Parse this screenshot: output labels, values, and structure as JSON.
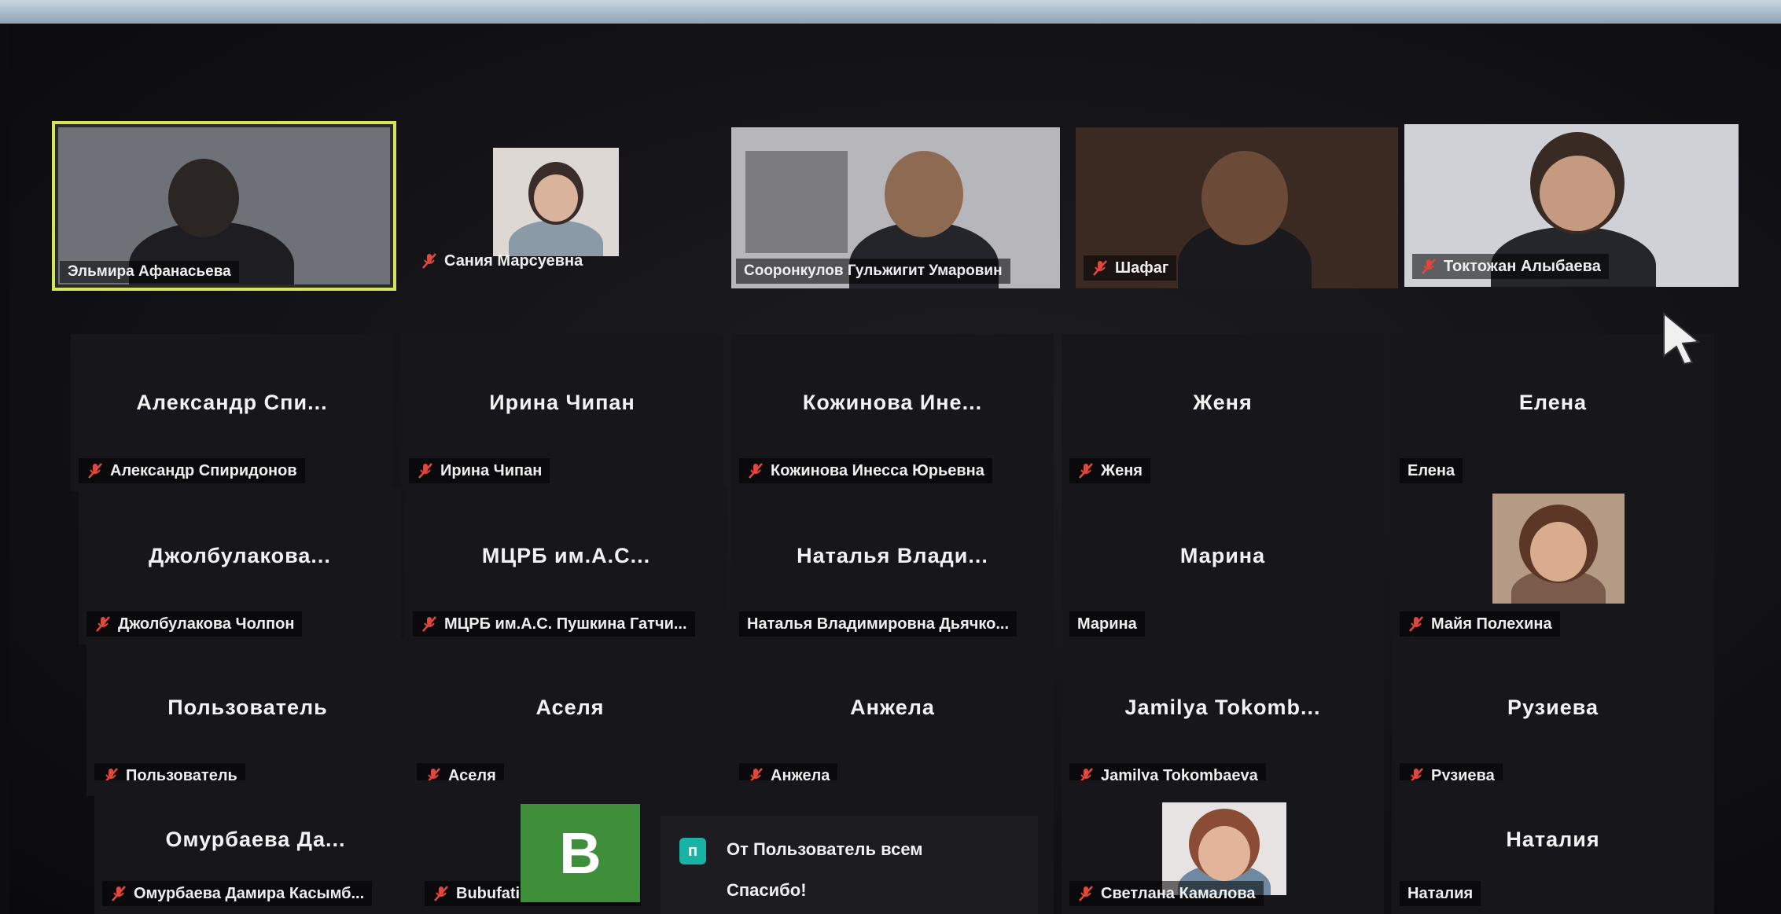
{
  "participants": [
    {
      "tile_name": "",
      "tag_name": "Эльмира Афанасьева",
      "muted": false,
      "video": true,
      "active": true
    },
    {
      "tile_name": "",
      "tag_name": "Сания Марсуевна",
      "muted": true,
      "video": true
    },
    {
      "tile_name": "",
      "tag_name": "Сооронкулов Гульжигит Умаровин",
      "muted": false,
      "video": true
    },
    {
      "tile_name": "",
      "tag_name": "Шафаг",
      "muted": true,
      "video": true
    },
    {
      "tile_name": "",
      "tag_name": "Токтожан Алыбаева",
      "muted": true,
      "video": true
    },
    {
      "tile_name": "Александр Спи...",
      "tag_name": "Александр Спиридонов",
      "muted": true
    },
    {
      "tile_name": "Ирина Чипан",
      "tag_name": "Ирина Чипан",
      "muted": true
    },
    {
      "tile_name": "Кожинова Ине...",
      "tag_name": "Кожинова Инесса Юрьевна",
      "muted": true
    },
    {
      "tile_name": "Женя",
      "tag_name": "Женя",
      "muted": true
    },
    {
      "tile_name": "Елена",
      "tag_name": "Елена",
      "muted": false
    },
    {
      "tile_name": "Джолбулакова...",
      "tag_name": "Джолбулакова Чолпон",
      "muted": true
    },
    {
      "tile_name": "МЦРБ им.А.С...",
      "tag_name": "МЦРБ им.А.С. Пушкина Гатчи...",
      "muted": true
    },
    {
      "tile_name": "Наталья Влади...",
      "tag_name": "Наталья Владимировна Дьячко...",
      "muted": false
    },
    {
      "tile_name": "Марина",
      "tag_name": "Марина",
      "muted": false
    },
    {
      "tile_name": "",
      "tag_name": "Майя Полехина",
      "muted": true,
      "video": true
    },
    {
      "tile_name": "Пользователь",
      "tag_name": "Пользователь",
      "muted": true
    },
    {
      "tile_name": "Аселя",
      "tag_name": "Аселя",
      "muted": true
    },
    {
      "tile_name": "Анжела",
      "tag_name": "Анжела",
      "muted": true
    },
    {
      "tile_name": "Jamilya Tokomb...",
      "tag_name": "Jamilya Tokombaeva",
      "muted": true
    },
    {
      "tile_name": "Рузиева",
      "tag_name": "Рузиева",
      "muted": true
    },
    {
      "tile_name": "Омурбаева Да...",
      "tag_name": "Омурбаева Дамира Касымб...",
      "muted": true
    },
    {
      "tile_name": "",
      "tag_name": "Bubufatima Toktobaeva",
      "muted": true,
      "avatar_letter": "B"
    },
    {
      "tile_name": "",
      "tag_name": "",
      "muted": false
    },
    {
      "tile_name": "",
      "tag_name": "Светлана Камалова",
      "muted": true,
      "video": true
    },
    {
      "tile_name": "Наталия",
      "tag_name": "Наталия",
      "muted": false
    }
  ],
  "chat": {
    "badge": "п",
    "from": "От Пользователь всем",
    "message": "Спасибо!"
  },
  "colors": {
    "active_speaker": "#d6e45a",
    "mute_icon": "#e0483e",
    "avatar_bg": "#3f8f3a",
    "chat_badge": "#19b3a6"
  }
}
